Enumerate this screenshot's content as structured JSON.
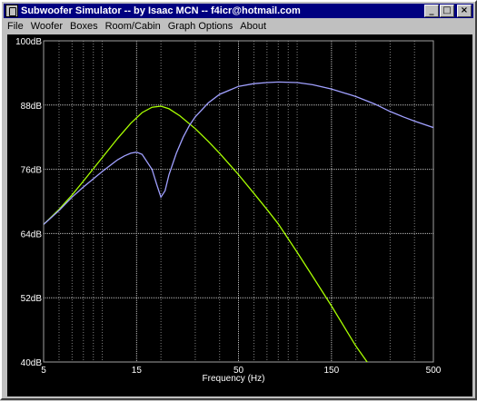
{
  "window": {
    "title": "Subwoofer Simulator -- by Isaac MCN -- f4icr@hotmail.com",
    "buttons": [
      "_",
      "□",
      "×"
    ]
  },
  "menu": [
    "File",
    "Woofer",
    "Boxes",
    "Room/Cabin",
    "Graph Options",
    "About"
  ],
  "chart_data": {
    "type": "line",
    "xlabel": "Frequency (Hz)",
    "ylabel": "",
    "xscale": "log",
    "xlim": [
      5,
      500
    ],
    "ylim": [
      40,
      100
    ],
    "x_ticks": [
      "5",
      "15",
      "50",
      "150",
      "500"
    ],
    "y_ticks": [
      "100dB",
      "88dB",
      "76dB",
      "64dB",
      "52dB",
      "40dB"
    ],
    "grid": true,
    "colors": {
      "background": "#000000",
      "grid": "#808080",
      "series1": "#a8ff00",
      "series2": "#a0a0ff"
    },
    "series": [
      {
        "x": [
          5,
          6,
          7,
          8,
          10,
          12,
          14,
          16,
          18,
          20,
          22,
          25,
          30,
          35,
          40,
          50,
          60,
          70,
          80,
          100,
          120,
          150,
          200,
          250,
          300
        ],
        "y": [
          65.7,
          68.5,
          71.2,
          73.8,
          78.2,
          81.8,
          84.6,
          86.6,
          87.6,
          87.8,
          87.3,
          86.0,
          83.6,
          81.2,
          79.0,
          75.0,
          71.5,
          68.5,
          65.8,
          60.5,
          56.0,
          50.5,
          43.0,
          38.0,
          34.0
        ]
      },
      {
        "x": [
          5,
          6,
          7,
          8,
          10,
          12,
          13,
          14,
          15,
          16,
          18,
          19,
          20,
          21,
          22,
          24,
          26,
          28,
          30,
          35,
          40,
          50,
          60,
          70,
          80,
          100,
          120,
          150,
          200,
          250,
          300,
          350,
          400,
          500
        ],
        "y": [
          65.7,
          68.3,
          70.8,
          72.7,
          75.6,
          77.8,
          78.5,
          79.0,
          79.2,
          78.8,
          76.0,
          73.2,
          70.8,
          72.0,
          75.0,
          79.0,
          82.0,
          84.2,
          85.8,
          88.4,
          90.0,
          91.5,
          92.0,
          92.2,
          92.3,
          92.2,
          91.8,
          91.0,
          89.6,
          88.2,
          86.8,
          85.8,
          85.0,
          83.8
        ]
      }
    ]
  }
}
